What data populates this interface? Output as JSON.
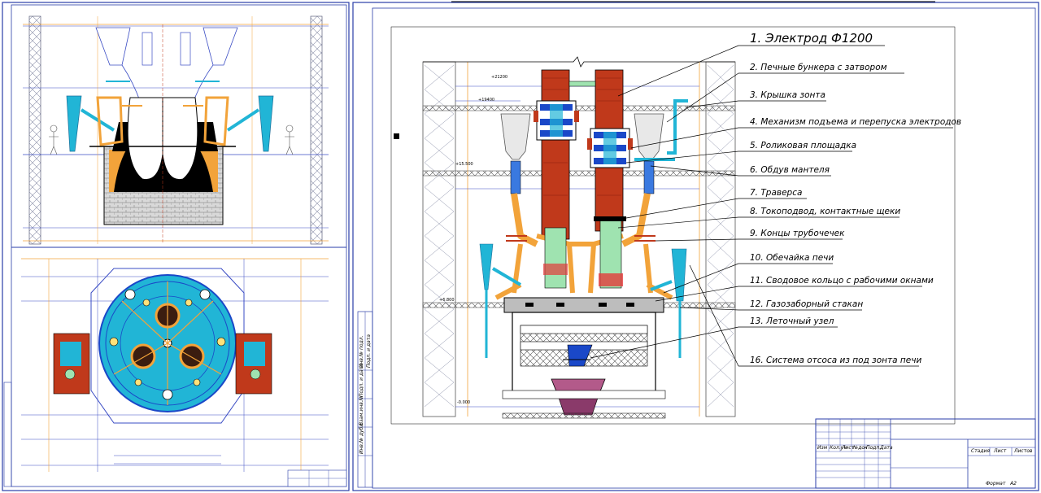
{
  "callouts": [
    {
      "num": "1.",
      "text": "Электрод Ф1200"
    },
    {
      "num": "2.",
      "text": "Печные бункера с затвором"
    },
    {
      "num": "3.",
      "text": "Крышка зонта"
    },
    {
      "num": "4.",
      "text": "Механизм подъема  и перепуска электродов"
    },
    {
      "num": "5.",
      "text": "Роликовая площадка"
    },
    {
      "num": "6.",
      "text": "Обдув мантеля"
    },
    {
      "num": "7.",
      "text": "Траверса"
    },
    {
      "num": "8.",
      "text": "Токоподвод, контактные щеки"
    },
    {
      "num": "9.",
      "text": "Концы трубочечек"
    },
    {
      "num": "10.",
      "text": "Обечайка печи"
    },
    {
      "num": "11.",
      "text": "Сводовое кольцо с рабочими окнами"
    },
    {
      "num": "12.",
      "text": "Газозаборный стакан"
    },
    {
      "num": "13.",
      "text": "Леточный узел"
    },
    {
      "num": "16.",
      "text": "Система отсоса из под зонта печи"
    }
  ],
  "levels": [
    "+21200",
    "+19400",
    "+15.500",
    "+6.800",
    "-0.000"
  ],
  "title_block": {
    "cols": [
      "Изм",
      "Кол.уч",
      "Лист",
      "№док",
      "Подп.",
      "Дата"
    ],
    "stage_label": "Стадия",
    "sheet_label": "Лист",
    "sheets_label": "Листов",
    "format_label": "Формат",
    "format_value": "А2"
  },
  "margin_stamp": [
    "Инв.№ подл.",
    "Подп. и дата",
    "Взам.инв.№",
    "Инв.№ дубл.",
    "Подп. и дата"
  ],
  "colors": {
    "electrode": "#c0391b",
    "cyan": "#21b5d6",
    "orange": "#f2a33a",
    "green": "#9fe3b0",
    "blue": "#1a48c8",
    "drawing_line": "#3a4cc4",
    "frame": "#2a3ea8",
    "black": "#000000",
    "magenta": "#b35a8a"
  }
}
